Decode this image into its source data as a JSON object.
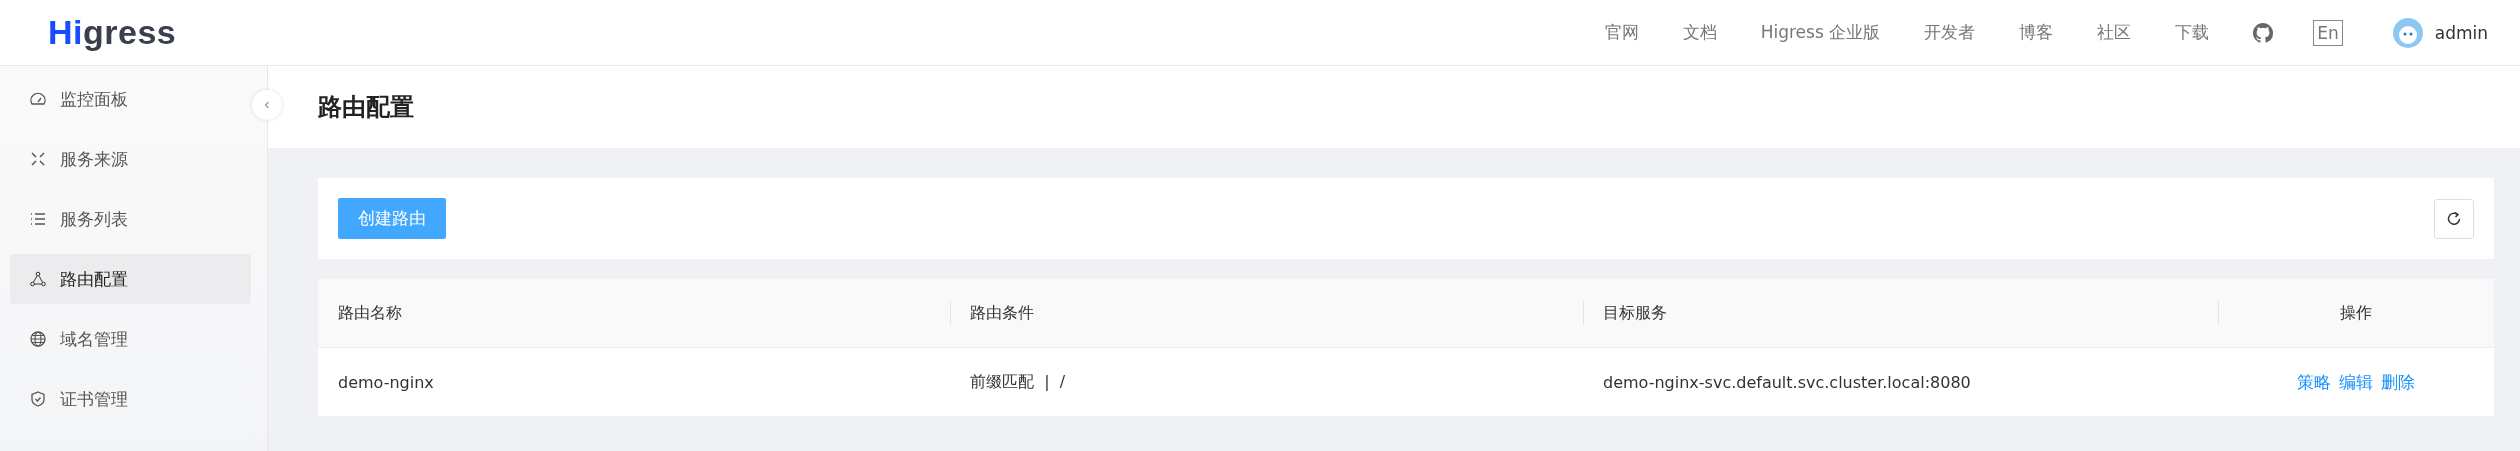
{
  "header": {
    "logo": "Higress",
    "nav": [
      {
        "label": "官网"
      },
      {
        "label": "文档"
      },
      {
        "label": "Higress 企业版"
      },
      {
        "label": "开发者"
      },
      {
        "label": "博客"
      },
      {
        "label": "社区"
      },
      {
        "label": "下载"
      }
    ],
    "language": "En",
    "user": "admin"
  },
  "sidebar": {
    "items": [
      {
        "label": "监控面板",
        "kind": "dashboard",
        "selected": false
      },
      {
        "label": "服务来源",
        "kind": "sources",
        "selected": false
      },
      {
        "label": "服务列表",
        "kind": "list",
        "selected": false
      },
      {
        "label": "路由配置",
        "kind": "route",
        "selected": true
      },
      {
        "label": "域名管理",
        "kind": "globe",
        "selected": false
      },
      {
        "label": "证书管理",
        "kind": "shield",
        "selected": false
      }
    ]
  },
  "page": {
    "title": "路由配置",
    "create_button": "创建路由"
  },
  "table": {
    "columns": [
      "路由名称",
      "路由条件",
      "目标服务",
      "操作"
    ],
    "rows": [
      {
        "name": "demo-nginx",
        "condition_type": "前缀匹配",
        "condition_separator": "|",
        "condition_path": "/",
        "target": "demo-nginx-svc.default.svc.cluster.local:8080",
        "actions": [
          "策略",
          "编辑",
          "删除"
        ]
      }
    ]
  }
}
